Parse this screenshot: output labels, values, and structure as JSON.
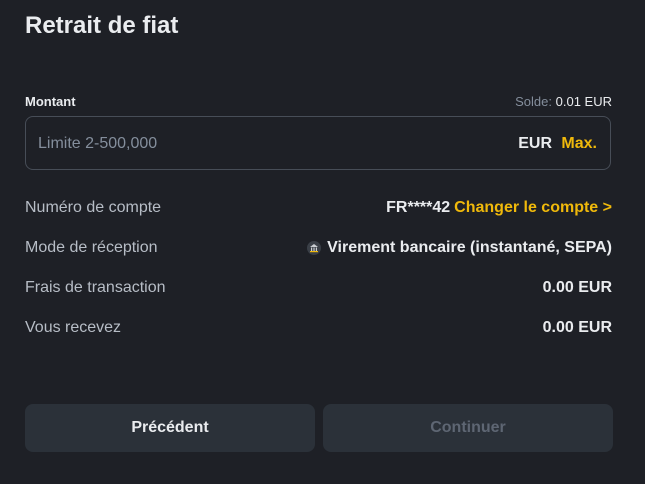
{
  "page": {
    "title": "Retrait de fiat"
  },
  "amount": {
    "label": "Montant",
    "balance_label": "Solde:",
    "balance_value": "0.01 EUR",
    "placeholder": "Limite 2-500,000",
    "value": "",
    "currency": "EUR",
    "max_label": "Max."
  },
  "details": {
    "account": {
      "label": "Numéro de compte",
      "value": "FR****42",
      "change_label": "Changer le compte >"
    },
    "mode": {
      "label": "Mode de réception",
      "icon": "bank-icon",
      "value": "Virement bancaire (instantané, SEPA)"
    },
    "fee": {
      "label": "Frais de transaction",
      "value": "0.00 EUR"
    },
    "receive": {
      "label": "Vous recevez",
      "value": "0.00 EUR"
    }
  },
  "buttons": {
    "previous": "Précédent",
    "continue": "Continuer"
  },
  "colors": {
    "accent": "#f0b90b",
    "background": "#1e2026",
    "button": "#2b3139",
    "disabled_text": "#5e6673"
  }
}
